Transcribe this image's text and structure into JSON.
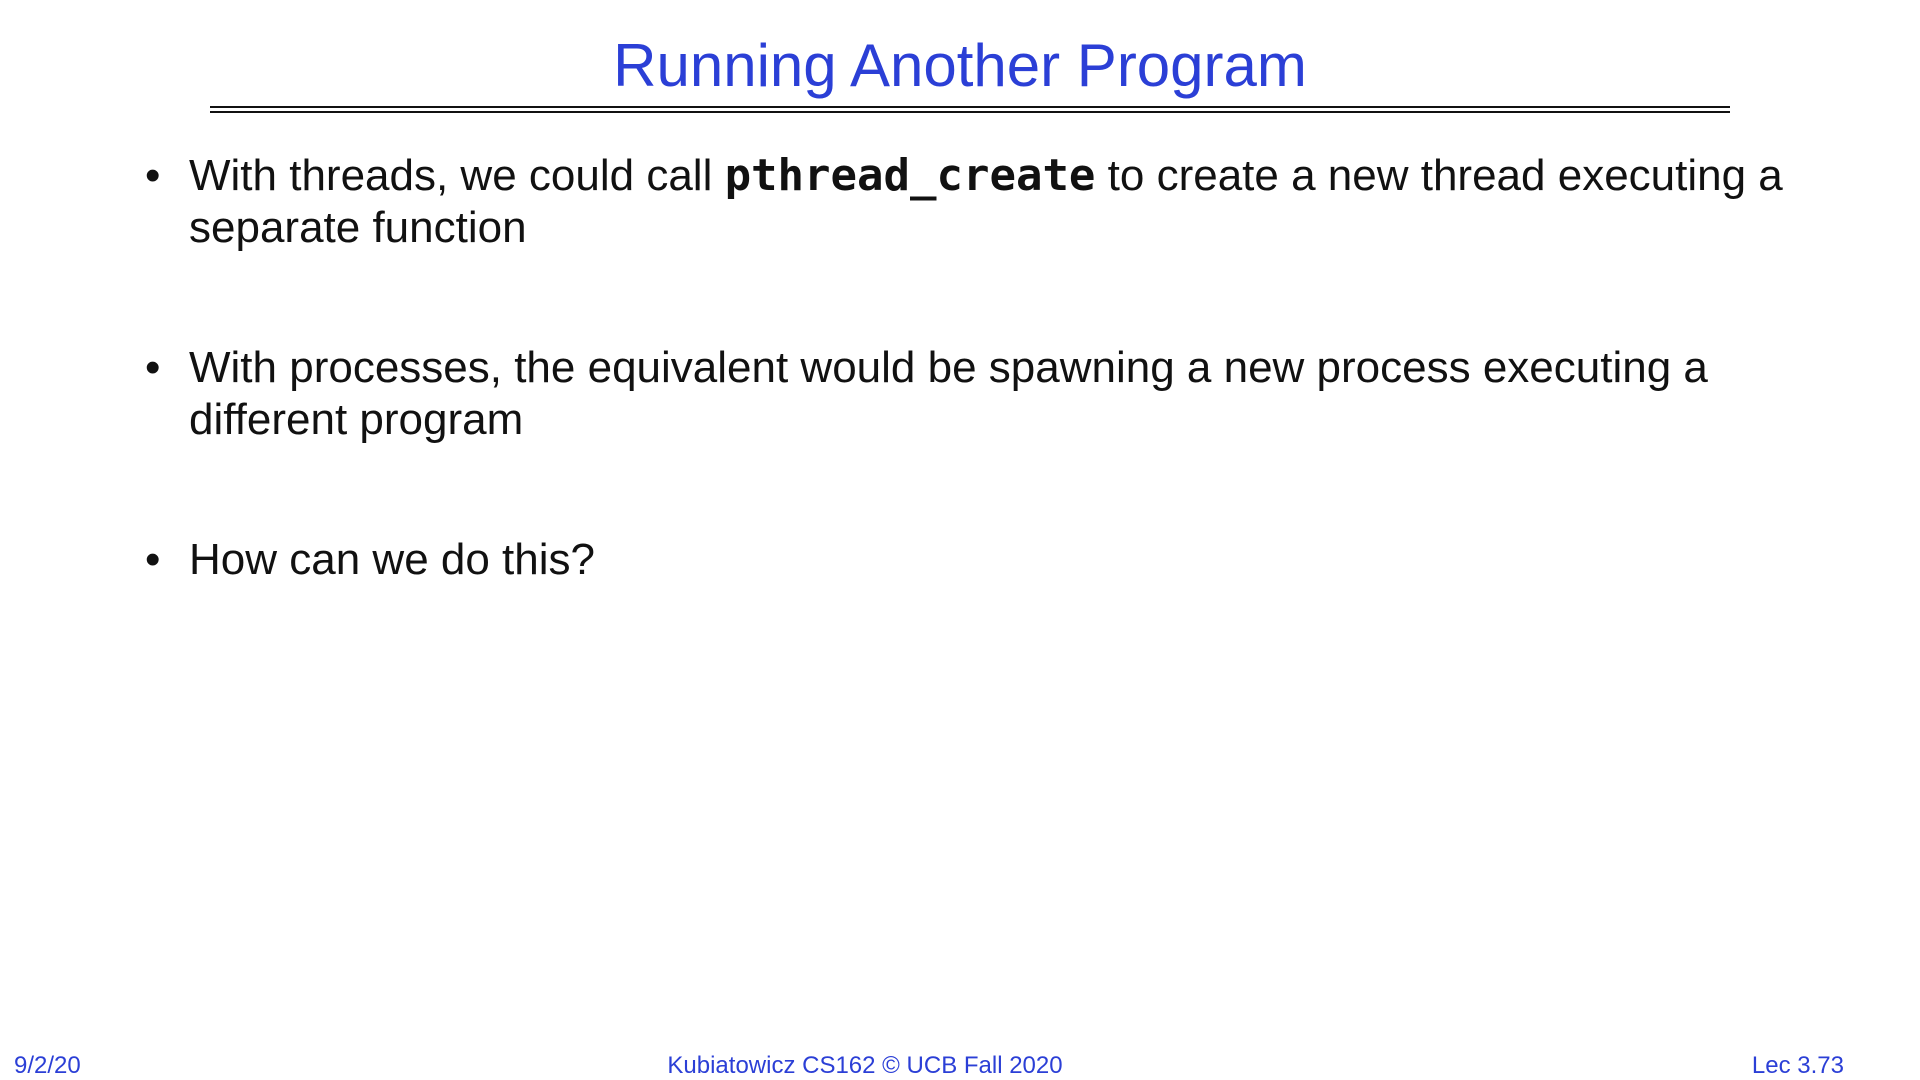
{
  "slide": {
    "title": "Running Another Program",
    "bullets": [
      {
        "text_before": "With threads, we could call ",
        "code": "pthread_create",
        "text_after": " to create a new thread executing a separate function"
      },
      {
        "text": "With processes, the equivalent would be spawning a new process executing a different program"
      },
      {
        "text": "How can we do this?"
      }
    ],
    "bullet_glyph": "•"
  },
  "footer": {
    "date": "9/2/20",
    "course": "Kubiatowicz CS162 © UCB Fall 2020",
    "lecture": "Lec 3.73"
  },
  "colors": {
    "accent": "#2b3fd6",
    "text": "#111111",
    "background": "#ffffff"
  }
}
